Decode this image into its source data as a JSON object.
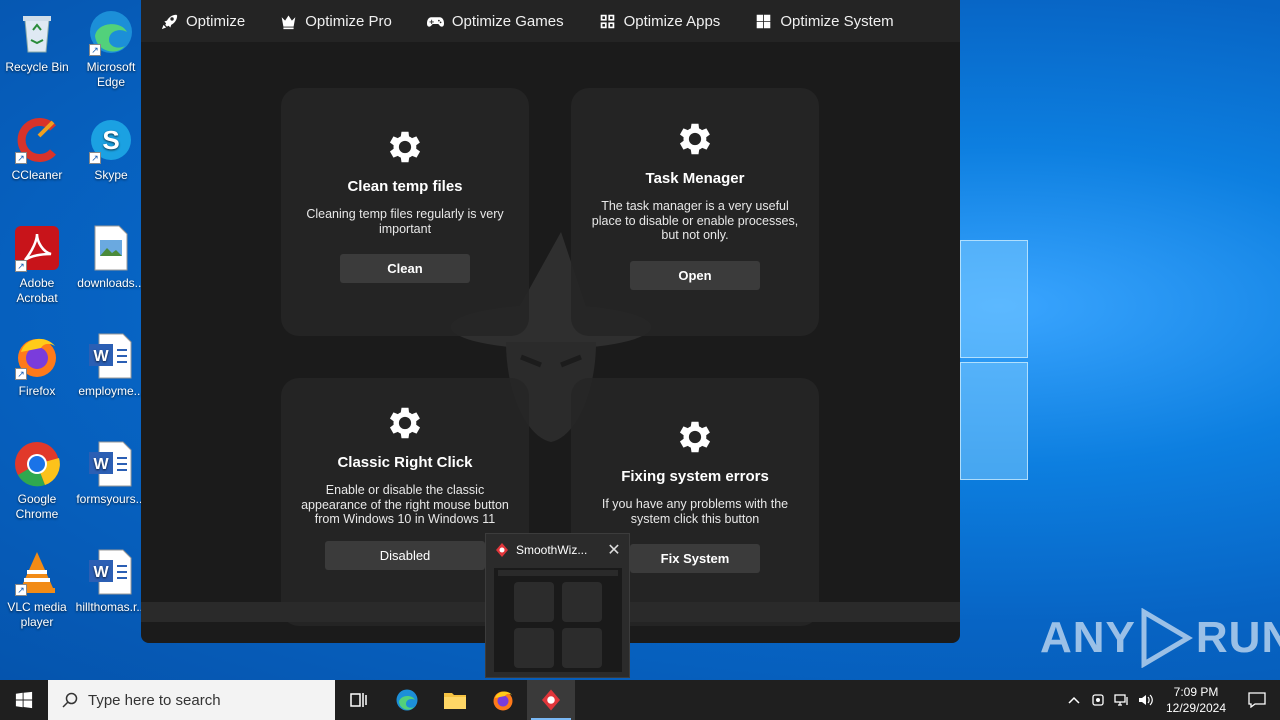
{
  "desktop": {
    "icons": [
      {
        "label": "Recycle Bin"
      },
      {
        "label": "Microsoft Edge"
      },
      {
        "label": "CCleaner"
      },
      {
        "label": "Skype"
      },
      {
        "label": "Adobe Acrobat"
      },
      {
        "label": "downloads..."
      },
      {
        "label": "Firefox"
      },
      {
        "label": "employme..."
      },
      {
        "label": "Google Chrome"
      },
      {
        "label": "formsyours..."
      },
      {
        "label": "VLC media player"
      },
      {
        "label": "hillthomas.r..."
      }
    ]
  },
  "app": {
    "nav": [
      {
        "label": "Optimize",
        "icon": "rocket-icon"
      },
      {
        "label": "Optimize Pro",
        "icon": "crown-icon"
      },
      {
        "label": "Optimize Games",
        "icon": "gamepad-icon"
      },
      {
        "label": "Optimize Apps",
        "icon": "apps-grid-icon"
      },
      {
        "label": "Optimize System",
        "icon": "windows-icon"
      }
    ],
    "cards": [
      {
        "title": "Clean temp files",
        "desc": "Cleaning temp files regularly is very important",
        "button": "Clean"
      },
      {
        "title": "Task Menager",
        "desc": "The task manager is a very useful place to disable or enable processes, but not only.",
        "button": "Open"
      },
      {
        "title": "Classic Right Click",
        "desc": "Enable or disable the classic appearance of the right mouse button from Windows 10 in Windows 11",
        "button": "Disabled"
      },
      {
        "title": "Fixing system errors",
        "desc": "If you have any problems with the system click this button",
        "button": "Fix System"
      }
    ]
  },
  "preview": {
    "title": "SmoothWiz..."
  },
  "taskbar": {
    "search_placeholder": "Type here to search",
    "time": "7:09 PM",
    "date": "12/29/2024"
  },
  "watermark": {
    "text_left": "ANY",
    "text_right": "RUN"
  },
  "colors": {
    "accent": "#0a78d4",
    "app_bg": "#1b1b1b",
    "card_bg": "#262626",
    "button_bg": "#3b3b3b"
  }
}
